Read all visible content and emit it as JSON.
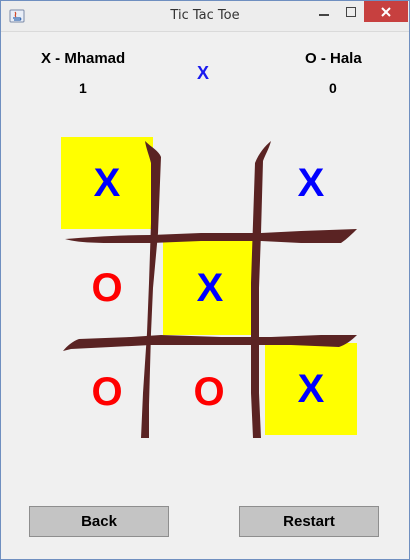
{
  "window": {
    "title": "Tic Tac Toe",
    "minimize_glyph": "—",
    "maximize_glyph": "□",
    "close_glyph": "✕"
  },
  "players": {
    "x": {
      "name": "X - Mhamad",
      "score": "1"
    },
    "o": {
      "name": "O - Hala",
      "score": "0"
    }
  },
  "turn": "X",
  "board": {
    "cells": [
      {
        "mark": "X",
        "winning": true
      },
      {
        "mark": "",
        "winning": false
      },
      {
        "mark": "X",
        "winning": false
      },
      {
        "mark": "O",
        "winning": false
      },
      {
        "mark": "X",
        "winning": true
      },
      {
        "mark": "",
        "winning": false
      },
      {
        "mark": "O",
        "winning": false
      },
      {
        "mark": "O",
        "winning": false
      },
      {
        "mark": "X",
        "winning": true
      }
    ]
  },
  "colors": {
    "x_mark": "#0000ff",
    "o_mark": "#ff0000",
    "win_highlight": "#ffff00",
    "grid_lines": "#5a2323"
  },
  "buttons": {
    "back": "Back",
    "restart": "Restart"
  }
}
